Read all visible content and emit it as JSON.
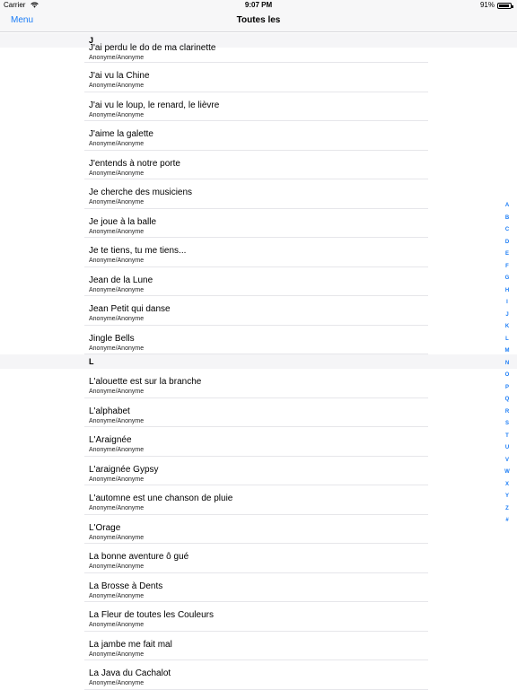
{
  "status": {
    "carrier": "Carrier",
    "time": "9:07 PM",
    "battery": "91%",
    "battery_level": 0.91
  },
  "nav": {
    "menu_label": "Menu",
    "title": "Toutes les"
  },
  "sections": [
    {
      "header": "J",
      "items": [
        {
          "title": "J'ai perdu le do de ma clarinette",
          "subtitle": "Anonyme/Anonyme"
        },
        {
          "title": "J'ai vu la Chine",
          "subtitle": "Anonyme/Anonyme"
        },
        {
          "title": "J'ai vu le loup, le renard, le lièvre",
          "subtitle": "Anonyme/Anonyme"
        },
        {
          "title": "J'aime la galette",
          "subtitle": "Anonyme/Anonyme"
        },
        {
          "title": "J'entends à notre porte",
          "subtitle": "Anonyme/Anonyme"
        },
        {
          "title": "Je cherche des musiciens",
          "subtitle": "Anonyme/Anonyme"
        },
        {
          "title": "Je joue à la balle",
          "subtitle": "Anonyme/Anonyme"
        },
        {
          "title": "Je te tiens, tu me tiens...",
          "subtitle": "Anonyme/Anonyme"
        },
        {
          "title": "Jean de la Lune",
          "subtitle": "Anonyme/Anonyme"
        },
        {
          "title": "Jean Petit qui danse",
          "subtitle": "Anonyme/Anonyme"
        },
        {
          "title": "Jingle Bells",
          "subtitle": "Anonyme/Anonyme"
        }
      ]
    },
    {
      "header": "L",
      "items": [
        {
          "title": "L'alouette est sur la branche",
          "subtitle": "Anonyme/Anonyme"
        },
        {
          "title": "L'alphabet",
          "subtitle": "Anonyme/Anonyme"
        },
        {
          "title": "L'Araignée",
          "subtitle": "Anonyme/Anonyme"
        },
        {
          "title": "L'araignée Gypsy",
          "subtitle": "Anonyme/Anonyme"
        },
        {
          "title": "L'automne est une chanson de pluie",
          "subtitle": "Anonyme/Anonyme"
        },
        {
          "title": "L'Orage",
          "subtitle": "Anonyme/Anonyme"
        },
        {
          "title": "La bonne aventure ô gué",
          "subtitle": "Anonyme/Anonyme"
        },
        {
          "title": "La Brosse à Dents",
          "subtitle": "Anonyme/Anonyme"
        },
        {
          "title": "La Fleur de toutes les Couleurs",
          "subtitle": "Anonyme/Anonyme"
        },
        {
          "title": "La jambe me fait mal",
          "subtitle": "Anonyme/Anonyme"
        },
        {
          "title": "La Java du Cachalot",
          "subtitle": "Anonyme/Anonyme"
        }
      ]
    }
  ],
  "index_letters": [
    "A",
    "B",
    "C",
    "D",
    "E",
    "F",
    "G",
    "H",
    "I",
    "J",
    "K",
    "L",
    "M",
    "N",
    "O",
    "P",
    "Q",
    "R",
    "S",
    "T",
    "U",
    "V",
    "W",
    "X",
    "Y",
    "Z",
    "#"
  ],
  "colors": {
    "accent": "#1a7cf6",
    "section_bg": "#f5f5f7",
    "bar_bg": "#f7f7f8"
  }
}
